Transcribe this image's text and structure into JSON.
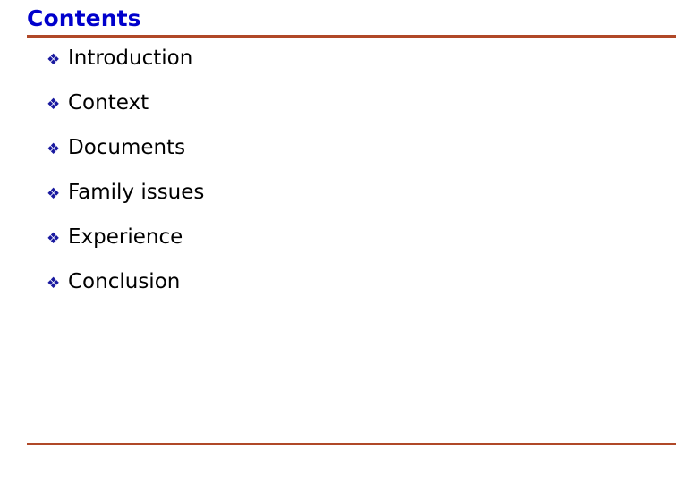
{
  "slide": {
    "title": "Contents",
    "title_color": "#0000CC",
    "background_color": "#FFFFFF",
    "rule_color": "#B04828",
    "bullet_color": "#1A1AA0",
    "text_color": "#000000",
    "bullet_glyph": "❖",
    "bullet_icon_name": "diamond-cluster-bullet-icon",
    "items": [
      {
        "label": "Introduction"
      },
      {
        "label": "Context"
      },
      {
        "label": "Documents"
      },
      {
        "label": "Family issues"
      },
      {
        "label": "Experience"
      },
      {
        "label": "Conclusion"
      }
    ]
  }
}
